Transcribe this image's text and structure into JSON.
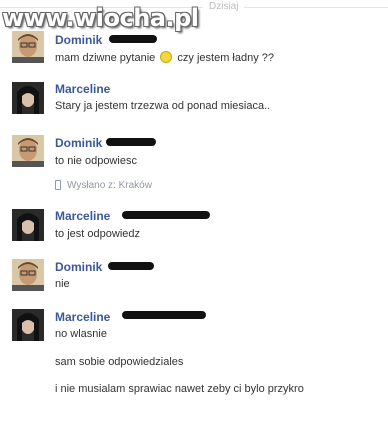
{
  "header": {
    "date_label": "Dzisiaj",
    "watermark": "www.wiocha.pl"
  },
  "messages": [
    {
      "sender": "Dominik",
      "lines": [
        "mam dziwne pytanie",
        "czy jestem ładny ??"
      ]
    },
    {
      "sender": "Marceline",
      "lines": [
        "Stary ja jestem trzezwa od ponad miesiaca.."
      ]
    },
    {
      "sender": "Dominik",
      "lines": [
        "to nie odpowiesc"
      ],
      "sent_from": "Wysłano z: Kraków"
    },
    {
      "sender": "Marceline",
      "lines": [
        "to jest odpowiedz"
      ]
    },
    {
      "sender": "Dominik",
      "lines": [
        "nie"
      ]
    },
    {
      "sender": "Marceline",
      "lines": [
        "no wlasnie",
        "sam sobie odpowiedziales",
        "i nie musialam sprawiac nawet zeby ci bylo przykro"
      ]
    }
  ],
  "icons": {
    "smiley": "smiley-icon",
    "phone": "phone-icon"
  }
}
